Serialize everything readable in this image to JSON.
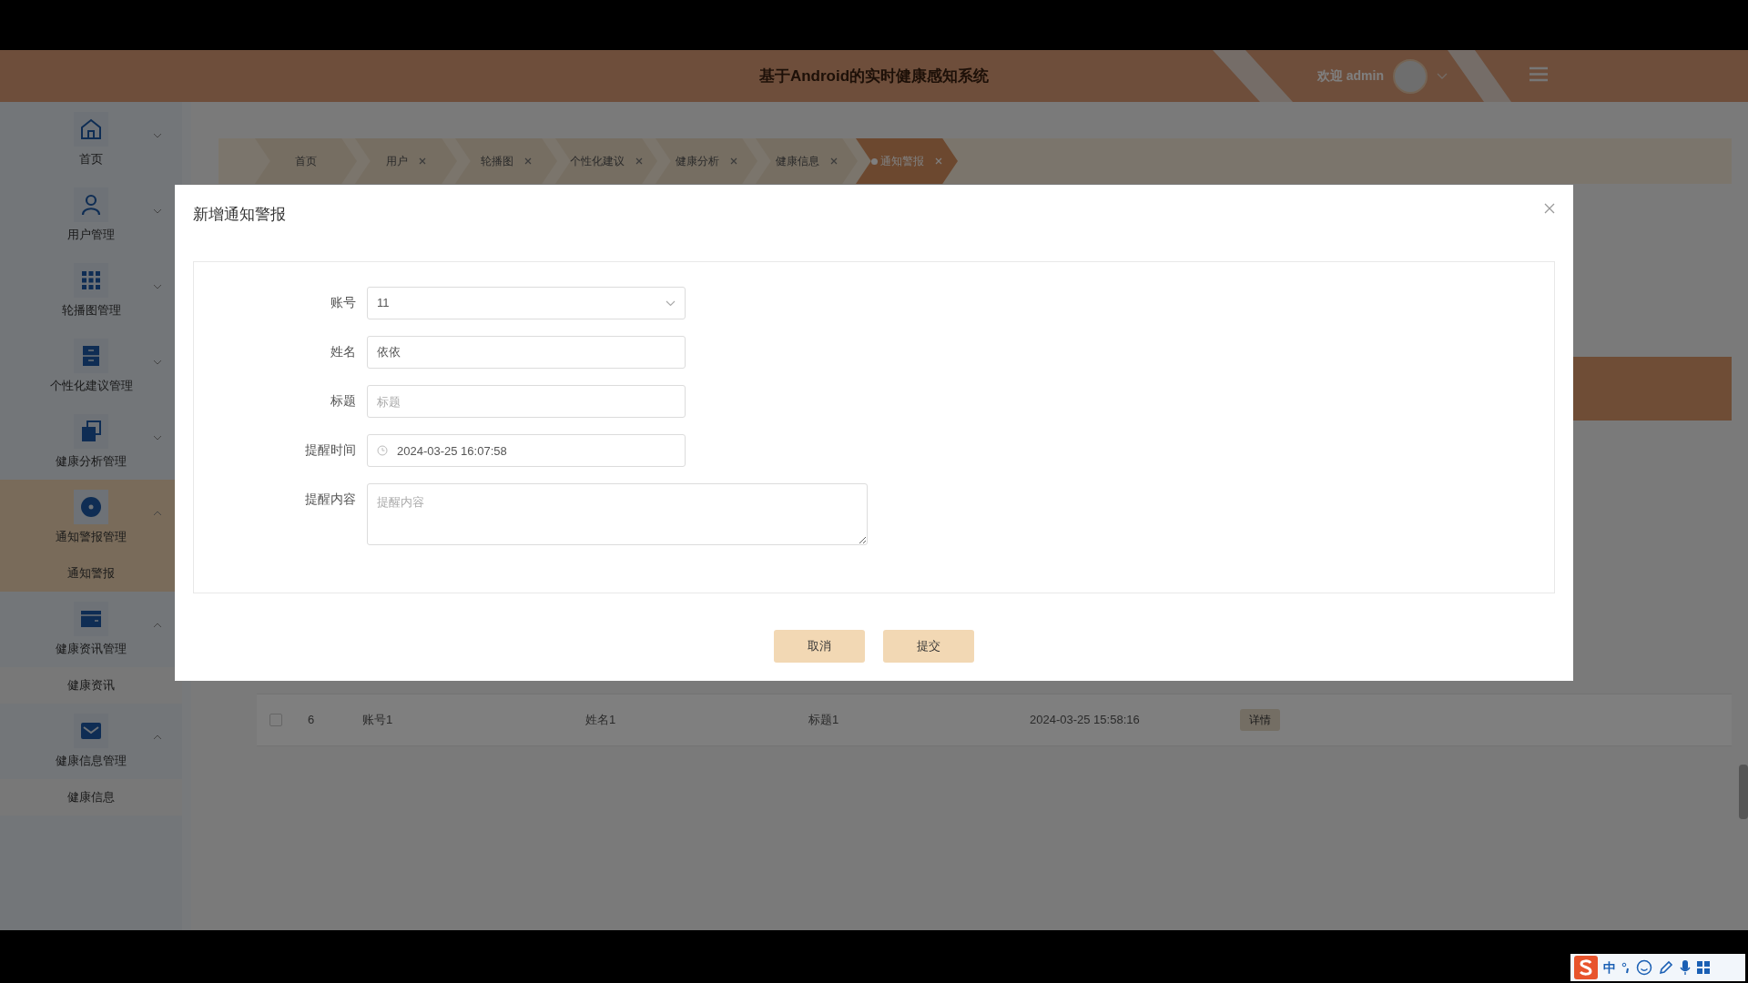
{
  "header": {
    "title": "基于Android的实时健康感知系统",
    "greeting": "欢迎 admin"
  },
  "sidebar": {
    "items": [
      {
        "label": "首页",
        "expanded": false,
        "selected": false
      },
      {
        "label": "用户管理",
        "expanded": false,
        "selected": false
      },
      {
        "label": "轮播图管理",
        "expanded": false,
        "selected": false
      },
      {
        "label": "个性化建议管理",
        "expanded": false,
        "selected": false
      },
      {
        "label": "健康分析管理",
        "expanded": false,
        "selected": false
      },
      {
        "label": "通知警报管理",
        "expanded": true,
        "selected": true,
        "children": [
          {
            "label": "通知警报",
            "selected": true
          }
        ]
      },
      {
        "label": "健康资讯管理",
        "expanded": true,
        "selected": false,
        "children": [
          {
            "label": "健康资讯",
            "selected": false
          }
        ]
      },
      {
        "label": "健康信息管理",
        "expanded": true,
        "selected": false,
        "children": [
          {
            "label": "健康信息",
            "selected": false
          }
        ]
      }
    ]
  },
  "tabs": [
    {
      "label": "首页",
      "closable": false,
      "selected": false
    },
    {
      "label": "用户",
      "closable": true,
      "selected": false
    },
    {
      "label": "轮播图",
      "closable": true,
      "selected": false
    },
    {
      "label": "个性化建议",
      "closable": true,
      "selected": false
    },
    {
      "label": "健康分析",
      "closable": true,
      "selected": false
    },
    {
      "label": "健康信息",
      "closable": true,
      "selected": false
    },
    {
      "label": "通知警报",
      "closable": true,
      "selected": true
    }
  ],
  "table": {
    "rows": [
      {
        "checked": false,
        "cells": [
          "6",
          "账号1",
          "姓名1",
          "标题1",
          "2024-03-25 15:58:16"
        ],
        "action": "详情"
      }
    ]
  },
  "dialog": {
    "title": "新增通知警报",
    "fields": [
      {
        "kind": "select",
        "label": "账号",
        "value": "11"
      },
      {
        "kind": "text",
        "label": "姓名",
        "value": "依依"
      },
      {
        "kind": "text",
        "label": "标题",
        "placeholder": "标题"
      },
      {
        "kind": "datetime",
        "label": "提醒时间",
        "value": "2024-03-25 16:07:58"
      },
      {
        "kind": "textarea",
        "label": "提醒内容",
        "placeholder": "提醒内容"
      }
    ],
    "buttons": [
      "取消",
      "提交"
    ]
  },
  "ime_bar": {
    "mode": "中"
  }
}
